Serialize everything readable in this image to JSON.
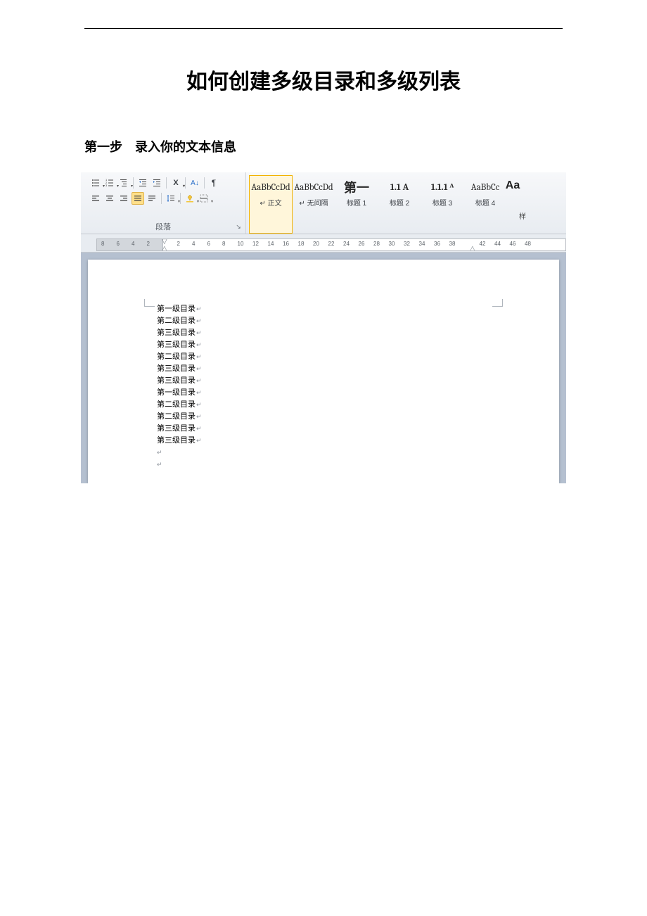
{
  "doc": {
    "title": "如何创建多级目录和多级列表",
    "step_heading": "第一步　录入你的文本信息"
  },
  "ribbon": {
    "paragraph": {
      "group_label": "段落",
      "row1_icons": [
        "bullets-icon",
        "numbering-icon",
        "multilevel-icon",
        "indent-decrease-icon",
        "indent-increase-icon",
        "show-marks-icon",
        "sort-icon",
        "pilcrow-icon"
      ],
      "row2_icons": [
        "align-left-icon",
        "align-center-icon",
        "align-right-icon",
        "justify-icon",
        "distribute-icon",
        "line-spacing-icon",
        "shading-icon",
        "borders-icon"
      ]
    },
    "styles": [
      {
        "preview": "AaBbCcDd",
        "label": "↵ 正文",
        "kind": "normal",
        "active": true
      },
      {
        "preview": "AaBbCcDd",
        "label": "↵ 无间隔",
        "kind": "normal"
      },
      {
        "preview": "第一",
        "label": "标题 1",
        "kind": "big"
      },
      {
        "preview": "1.1 A",
        "label": "标题 2",
        "kind": "bold"
      },
      {
        "preview": "1.1.1 ᴬ",
        "label": "标题 3",
        "kind": "bold"
      },
      {
        "preview": "AaBbCc",
        "label": "标题 4",
        "kind": "normal"
      }
    ],
    "styles_extra": "Aa",
    "more_label": "样"
  },
  "ruler": {
    "ticks": [
      "8",
      "6",
      "4",
      "2",
      "",
      "2",
      "4",
      "6",
      "8",
      "10",
      "12",
      "14",
      "16",
      "18",
      "20",
      "22",
      "24",
      "26",
      "28",
      "30",
      "32",
      "34",
      "36",
      "38",
      "",
      "42",
      "44",
      "46",
      "48"
    ]
  },
  "content_lines": [
    "第一级目录",
    "第二级目录",
    "第三级目录",
    "第三级目录",
    "第二级目录",
    "第三级目录",
    "第三级目录",
    "第一级目录",
    "第二级目录",
    "第二级目录",
    "第三级目录",
    "第三级目录"
  ]
}
